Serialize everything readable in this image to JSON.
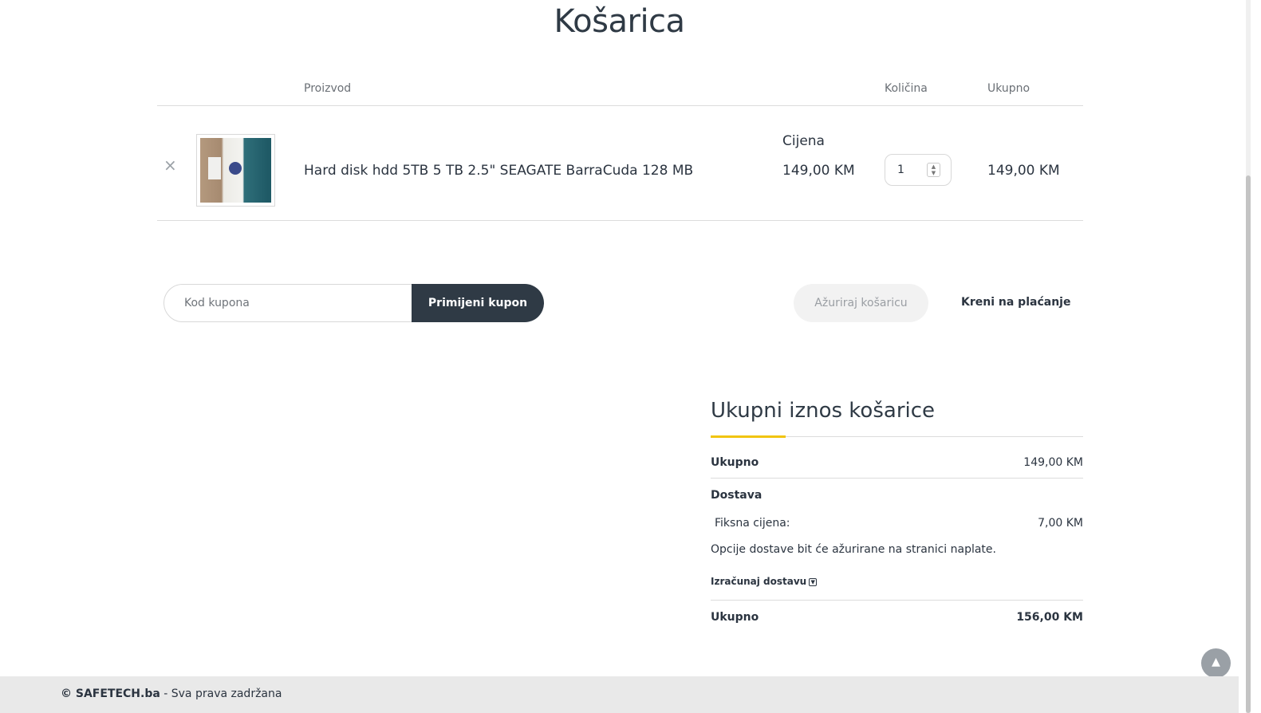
{
  "page": {
    "title": "Košarica"
  },
  "table": {
    "headers": {
      "product": "Proizvod",
      "price": "Cijena",
      "quantity": "Količina",
      "total": "Ukupno"
    },
    "items": [
      {
        "remove_icon": "×",
        "name": "Hard disk hdd 5TB 5 TB 2.5\" SEAGATE BarraCuda 128 MB",
        "price": "149,00 KM",
        "quantity": "1",
        "total": "149,00 KM"
      }
    ]
  },
  "coupon": {
    "placeholder": "Kod kupona",
    "apply_label": "Primijeni kupon"
  },
  "actions": {
    "update_label": "Ažuriraj košaricu",
    "checkout_label": "Kreni na plaćanje"
  },
  "totals": {
    "title": "Ukupni iznos košarice",
    "subtotal_label": "Ukupno",
    "subtotal_value": "149,00 KM",
    "shipping_label": "Dostava",
    "shipping_method": "Fiksna cijena:",
    "shipping_price": "7,00 KM",
    "shipping_note": "Opcije dostave bit će ažurirane na stranici naplate.",
    "calc_shipping_label": "Izračunaj dostavu",
    "grand_label": "Ukupno",
    "grand_value": "156,00 KM",
    "accent_color": "#f1c40f"
  },
  "footer": {
    "copyright": "© SAFETECH.ba",
    "rights": " - Sva prava zadržana"
  }
}
